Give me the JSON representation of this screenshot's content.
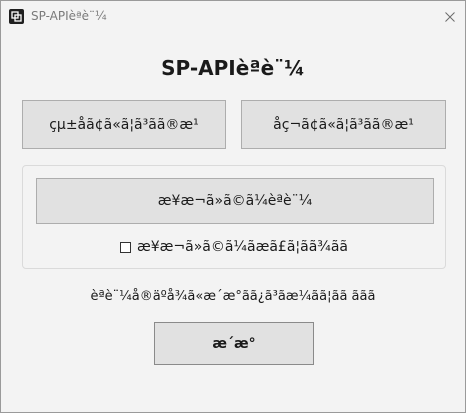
{
  "window": {
    "title": "SP-APIèªè¨¼"
  },
  "heading": "SP-APIèªè¨¼",
  "buttons": {
    "integrated_account": "çµ±åã¢ã«ã¦ã³ãã®æ¹",
    "single_account": "åç¬ã¢ã«ã¦ã³ãã®æ¹",
    "japan_seller_auth": "æ¥æ¬ã»ã©ã¼èªè¨¼",
    "update": "æ´æ°"
  },
  "checkbox": {
    "label": "æ¥æ¬ã»ã©ã¼ãæã£ã¦ãã¾ãã",
    "checked": false
  },
  "instruction": "èªè¨¼å®äºå¾ã«æ´æ°ãã¿ã³ãæ¼ãã¦ãã ããã",
  "icons": {
    "app": "app-logo-icon",
    "close": "close-icon"
  }
}
